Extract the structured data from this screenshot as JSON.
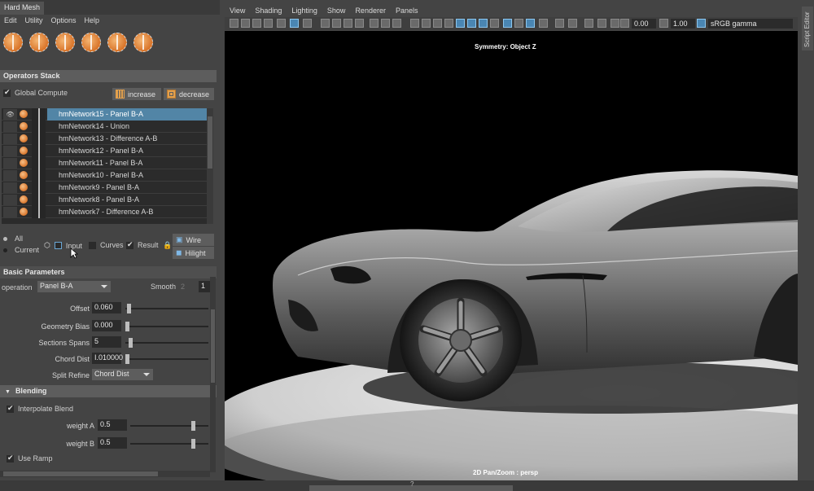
{
  "panel": {
    "tab": "Hard Mesh",
    "menu": [
      "Edit",
      "Utility",
      "Options",
      "Help"
    ],
    "shelf_icons": [
      "sphere-cut-icon-1",
      "sphere-cut-icon-2",
      "sphere-cut-icon-3",
      "sphere-cut-icon-4",
      "sphere-cut-icon-5",
      "sphere-cut-icon-6"
    ]
  },
  "operators": {
    "header": "Operators Stack",
    "global_compute": "Global Compute",
    "global_compute_checked": true,
    "increase_label": "increase",
    "decrease_label": "decrease",
    "items": [
      {
        "name": "hmNetwork15 - Panel B-A",
        "selected": true
      },
      {
        "name": "hmNetwork14 - Union",
        "selected": false
      },
      {
        "name": "hmNetwork13 - Difference A-B",
        "selected": false
      },
      {
        "name": "hmNetwork12 - Panel B-A",
        "selected": false
      },
      {
        "name": "hmNetwork11 - Panel B-A",
        "selected": false
      },
      {
        "name": "hmNetwork10 - Panel B-A",
        "selected": false
      },
      {
        "name": "hmNetwork9 - Panel B-A",
        "selected": false
      },
      {
        "name": "hmNetwork8 - Panel B-A",
        "selected": false
      },
      {
        "name": "hmNetwork7 - Difference A-B",
        "selected": false
      }
    ],
    "radio_all": "All",
    "radio_current": "Current",
    "input_label": "Input",
    "curves_label": "Curves",
    "result_label": "Result",
    "wire_label": "Wire",
    "hilight_label": "Hilight"
  },
  "basic": {
    "header": "Basic Parameters",
    "operation_label": "operation",
    "operation_value": "Panel B-A",
    "smooth_label": "Smooth",
    "smooth_value": "2",
    "smooth_value2": "1",
    "offset_label": "Offset",
    "offset_value": "0.060",
    "geometry_bias_label": "Geometry Bias",
    "geometry_bias_value": "0.000",
    "sections_spans_label": "Sections Spans",
    "sections_spans_value": "5",
    "chord_dist_label": "Chord Dist",
    "chord_dist_value": "I.010000",
    "split_refine_label": "Split Refine",
    "split_refine_value": "Chord Dist"
  },
  "blending": {
    "header": "Blending",
    "interpolate_blend": "Interpolate Blend",
    "weight_a_label": "weight A",
    "weight_a_value": "0.5",
    "weight_b_label": "weight B",
    "weight_b_value": "0.5",
    "use_ramp": "Use Ramp"
  },
  "viewport": {
    "menu": [
      "View",
      "Shading",
      "Lighting",
      "Show",
      "Renderer",
      "Panels"
    ],
    "exposure": "0.00",
    "gamma": "1.00",
    "color_space": "sRGB gamma",
    "symmetry_label": "Symmetry: Object Z",
    "camera_label": "2D Pan/Zoom : persp"
  },
  "script_editor_label": "Script Editor",
  "status_mark": "?",
  "colors": {
    "selected_row": "#5285a6",
    "accent_orange": "#e3a04c",
    "panel_bg": "#444444",
    "viewport_bg": "#000000"
  }
}
